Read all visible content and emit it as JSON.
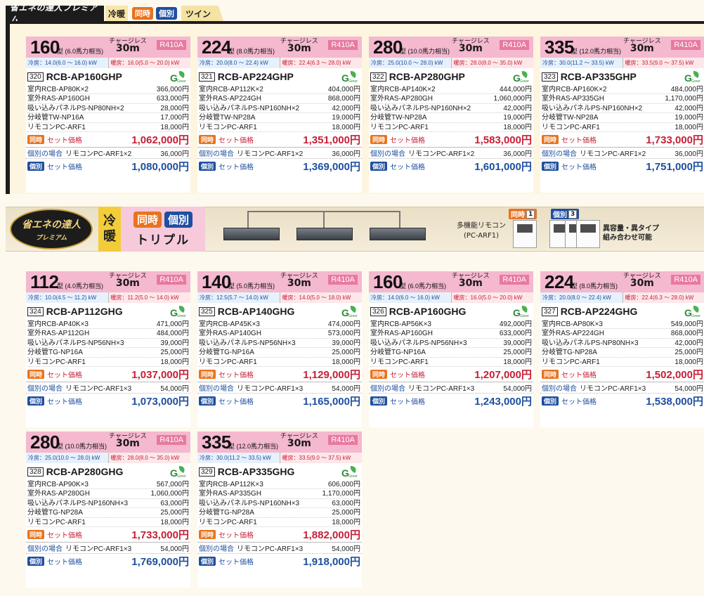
{
  "section1": {
    "logo": "省エネの達人プレミアム",
    "mode": "冷暖",
    "sim_label": "同時",
    "ind_label": "個別",
    "type": "ツイン"
  },
  "section2": {
    "logo_line1": "省エネの達人",
    "logo_line2": "プレミアム",
    "mode_line1": "冷",
    "mode_line2": "暖",
    "sim_label": "同時",
    "ind_label": "個別",
    "type": "トリプル",
    "remote_line1": "多機能リモコン",
    "remote_line2": "(PC-ARF1)",
    "sim_badge_label": "同時",
    "sim_badge_num": "1",
    "ind_badge_label": "個別",
    "ind_badge_num": "3",
    "note_line1": "異容量・異タイプ",
    "note_line2": "組み合わせ可能"
  },
  "common": {
    "charge_label": "チャージレス",
    "charge_len": "30m",
    "refrigerant": "R410A",
    "sim_badge": "同時",
    "ind_badge": "個別",
    "set_price_label": "セット価格",
    "ind_case_label": "個別の場合",
    "green_label": "Green"
  },
  "cards": [
    {
      "cap": "160",
      "hp": "型 (6.0馬力相当)",
      "cool": "冷房：14.0(6.0 〜 16.0) kW",
      "heat": "暖房：16.0(5.0 〜 20.0) kW",
      "no": "320",
      "model": "RCB-AP160GHP",
      "items": [
        {
          "name": "室内RCB-AP80K×2",
          "price": "366,000円"
        },
        {
          "name": "室外RAS-AP160GH",
          "price": "633,000円"
        },
        {
          "name": "吸い込みパネルPS-NP80NH×2",
          "price": "28,000円"
        },
        {
          "name": "分岐管TW-NP16A",
          "price": "17,000円"
        },
        {
          "name": "リモコンPC-ARF1",
          "price": "18,000円"
        }
      ],
      "sim_total": "1,062,000円",
      "ind_remote": "リモコンPC-ARF1×2",
      "ind_remote_price": "36,000円",
      "ind_total": "1,080,000円"
    },
    {
      "cap": "224",
      "hp": "型 (8.0馬力相当)",
      "cool": "冷房：20.0(8.0 〜 22.4) kW",
      "heat": "暖房：22.4(6.3 〜 28.0) kW",
      "no": "321",
      "model": "RCB-AP224GHP",
      "items": [
        {
          "name": "室内RCB-AP112K×2",
          "price": "404,000円"
        },
        {
          "name": "室外RAS-AP224GH",
          "price": "868,000円"
        },
        {
          "name": "吸い込みパネルPS-NP160NH×2",
          "price": "42,000円"
        },
        {
          "name": "分岐管TW-NP28A",
          "price": "19,000円"
        },
        {
          "name": "リモコンPC-ARF1",
          "price": "18,000円"
        }
      ],
      "sim_total": "1,351,000円",
      "ind_remote": "リモコンPC-ARF1×2",
      "ind_remote_price": "36,000円",
      "ind_total": "1,369,000円"
    },
    {
      "cap": "280",
      "hp": "型 (10.0馬力相当)",
      "cool": "冷房：25.0(10.0 〜 28.0) kW",
      "heat": "暖房：28.0(8.0 〜 35.0) kW",
      "no": "322",
      "model": "RCB-AP280GHP",
      "items": [
        {
          "name": "室内RCB-AP140K×2",
          "price": "444,000円"
        },
        {
          "name": "室外RAS-AP280GH",
          "price": "1,060,000円"
        },
        {
          "name": "吸い込みパネルPS-NP160NH×2",
          "price": "42,000円"
        },
        {
          "name": "分岐管TW-NP28A",
          "price": "19,000円"
        },
        {
          "name": "リモコンPC-ARF1",
          "price": "18,000円"
        }
      ],
      "sim_total": "1,583,000円",
      "ind_remote": "リモコンPC-ARF1×2",
      "ind_remote_price": "36,000円",
      "ind_total": "1,601,000円"
    },
    {
      "cap": "335",
      "hp": "型 (12.0馬力相当)",
      "cool": "冷房：30.0(11.2 〜 33.5) kW",
      "heat": "暖房：33.5(9.0 〜 37.5) kW",
      "no": "323",
      "model": "RCB-AP335GHP",
      "items": [
        {
          "name": "室内RCB-AP160K×2",
          "price": "484,000円"
        },
        {
          "name": "室外RAS-AP335GH",
          "price": "1,170,000円"
        },
        {
          "name": "吸い込みパネルPS-NP160NH×2",
          "price": "42,000円"
        },
        {
          "name": "分岐管TW-NP28A",
          "price": "19,000円"
        },
        {
          "name": "リモコンPC-ARF1",
          "price": "18,000円"
        }
      ],
      "sim_total": "1,733,000円",
      "ind_remote": "リモコンPC-ARF1×2",
      "ind_remote_price": "36,000円",
      "ind_total": "1,751,000円"
    },
    {
      "cap": "112",
      "hp": "型 (4.0馬力相当)",
      "cool": "冷房：10.0(4.5 〜 11.2) kW",
      "heat": "暖房：11.2(5.0 〜 14.0) kW",
      "no": "324",
      "model": "RCB-AP112GHG",
      "items": [
        {
          "name": "室内RCB-AP40K×3",
          "price": "471,000円"
        },
        {
          "name": "室外RAS-AP112GH",
          "price": "484,000円"
        },
        {
          "name": "吸い込みパネルPS-NP56NH×3",
          "price": "39,000円"
        },
        {
          "name": "分岐管TG-NP16A",
          "price": "25,000円"
        },
        {
          "name": "リモコンPC-ARF1",
          "price": "18,000円"
        }
      ],
      "sim_total": "1,037,000円",
      "ind_remote": "リモコンPC-ARF1×3",
      "ind_remote_price": "54,000円",
      "ind_total": "1,073,000円"
    },
    {
      "cap": "140",
      "hp": "型 (5.0馬力相当)",
      "cool": "冷房：12.5(5.7 〜 14.0) kW",
      "heat": "暖房：14.0(5.0 〜 18.0) kW",
      "no": "325",
      "model": "RCB-AP140GHG",
      "items": [
        {
          "name": "室内RCB-AP45K×3",
          "price": "474,000円"
        },
        {
          "name": "室外RAS-AP140GH",
          "price": "573,000円"
        },
        {
          "name": "吸い込みパネルPS-NP56NH×3",
          "price": "39,000円"
        },
        {
          "name": "分岐管TG-NP16A",
          "price": "25,000円"
        },
        {
          "name": "リモコンPC-ARF1",
          "price": "18,000円"
        }
      ],
      "sim_total": "1,129,000円",
      "ind_remote": "リモコンPC-ARF1×3",
      "ind_remote_price": "54,000円",
      "ind_total": "1,165,000円"
    },
    {
      "cap": "160",
      "hp": "型 (6.0馬力相当)",
      "cool": "冷房：14.0(6.0 〜 16.0) kW",
      "heat": "暖房：16.0(5.0 〜 20.0) kW",
      "no": "326",
      "model": "RCB-AP160GHG",
      "items": [
        {
          "name": "室内RCB-AP56K×3",
          "price": "492,000円"
        },
        {
          "name": "室外RAS-AP160GH",
          "price": "633,000円"
        },
        {
          "name": "吸い込みパネルPS-NP56NH×3",
          "price": "39,000円"
        },
        {
          "name": "分岐管TG-NP16A",
          "price": "25,000円"
        },
        {
          "name": "リモコンPC-ARF1",
          "price": "18,000円"
        }
      ],
      "sim_total": "1,207,000円",
      "ind_remote": "リモコンPC-ARF1×3",
      "ind_remote_price": "54,000円",
      "ind_total": "1,243,000円"
    },
    {
      "cap": "224",
      "hp": "型 (8.0馬力相当)",
      "cool": "冷房：20.0(8.0 〜 22.4) kW",
      "heat": "暖房：22.4(6.3 〜 28.0) kW",
      "no": "327",
      "model": "RCB-AP224GHG",
      "items": [
        {
          "name": "室内RCB-AP80K×3",
          "price": "549,000円"
        },
        {
          "name": "室外RAS-AP224GH",
          "price": "868,000円"
        },
        {
          "name": "吸い込みパネルPS-NP80NH×3",
          "price": "42,000円"
        },
        {
          "name": "分岐管TG-NP28A",
          "price": "25,000円"
        },
        {
          "name": "リモコンPC-ARF1",
          "price": "18,000円"
        }
      ],
      "sim_total": "1,502,000円",
      "ind_remote": "リモコンPC-ARF1×3",
      "ind_remote_price": "54,000円",
      "ind_total": "1,538,000円"
    },
    {
      "cap": "280",
      "hp": "型 (10.0馬力相当)",
      "cool": "冷房：25.0(10.0 〜 28.0) kW",
      "heat": "暖房：28.0(8.0 〜 35.0) kW",
      "no": "328",
      "model": "RCB-AP280GHG",
      "items": [
        {
          "name": "室内RCB-AP90K×3",
          "price": "567,000円"
        },
        {
          "name": "室外RAS-AP280GH",
          "price": "1,060,000円"
        },
        {
          "name": "吸い込みパネルPS-NP160NH×3",
          "price": "63,000円"
        },
        {
          "name": "分岐管TG-NP28A",
          "price": "25,000円"
        },
        {
          "name": "リモコンPC-ARF1",
          "price": "18,000円"
        }
      ],
      "sim_total": "1,733,000円",
      "ind_remote": "リモコンPC-ARF1×3",
      "ind_remote_price": "54,000円",
      "ind_total": "1,769,000円"
    },
    {
      "cap": "335",
      "hp": "型 (12.0馬力相当)",
      "cool": "冷房：30.0(11.2 〜 33.5) kW",
      "heat": "暖房：33.5(9.0 〜 37.5) kW",
      "no": "329",
      "model": "RCB-AP335GHG",
      "items": [
        {
          "name": "室内RCB-AP112K×3",
          "price": "606,000円"
        },
        {
          "name": "室外RAS-AP335GH",
          "price": "1,170,000円"
        },
        {
          "name": "吸い込みパネルPS-NP160NH×3",
          "price": "63,000円"
        },
        {
          "name": "分岐管TG-NP28A",
          "price": "25,000円"
        },
        {
          "name": "リモコンPC-ARF1",
          "price": "18,000円"
        }
      ],
      "sim_total": "1,882,000円",
      "ind_remote": "リモコンPC-ARF1×3",
      "ind_remote_price": "54,000円",
      "ind_total": "1,918,000円"
    }
  ]
}
